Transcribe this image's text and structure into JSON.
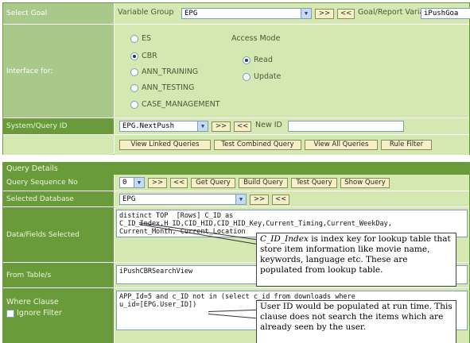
{
  "goal": {
    "label": "Select Goal",
    "variable_group_label": "Variable Group",
    "variable_group_value": "EPG",
    "next_btn": ">>",
    "prev_btn": "<<",
    "report_var_label": "Goal/Report Variable",
    "report_var_value": "iPushGoa"
  },
  "interface": {
    "label": "Interface for:",
    "options": [
      "ES",
      "CBR",
      "ANN_TRAINING",
      "ANN_TESTING",
      "CASE_MANAGEMENT"
    ],
    "selected": "CBR",
    "access_mode_label": "Access Mode",
    "access_options": [
      "Read",
      "Update"
    ],
    "access_selected": "Read"
  },
  "system_query": {
    "label": "System/Query ID",
    "value": "EPG.NextPush",
    "next_btn": ">>",
    "prev_btn": "<<",
    "new_id_label": "New ID",
    "new_id_value": ""
  },
  "query_buttons": [
    "View Linked Queries",
    "Test Combined Query",
    "View All Queries",
    "Rule Filter"
  ],
  "query_details": {
    "header": "Query Details",
    "sequence_label": "Query Sequence No",
    "sequence_value": "0",
    "next_btn": ">>",
    "prev_btn": "<<",
    "buttons": [
      "Get Query",
      "Build Query",
      "Test Query",
      "Show Query"
    ],
    "database_label": "Selected Database",
    "database_value": "EPG",
    "fields_label": "Data/Fields Selected",
    "fields_value": "distinct TOP  [Rows] C_ID as\nC_ID_Index,H_ID,CID_HID,CID_HID_Key,Current_Timing,Current_WeekDay,\nCurrent_Month, Current_Location",
    "from_label": "From Table/s",
    "from_value": "iPushCBRSearchView",
    "where_label": "Where Clause",
    "ignore_filter_label": "Ignore Filter",
    "where_value": "APP_Id=5 and c_ID not in (select c_id from downloads where\nu_id=[EPG.User_ID])"
  },
  "callouts": {
    "index_key_term": "C_ID_Index",
    "index_key_text": " is index key for lookup table that store item information like movie name, keywords, language etc. These are populated from lookup table.",
    "user_id_text": "User ID would be populated at run time. This clause does not search the items which are already seen by the user."
  }
}
